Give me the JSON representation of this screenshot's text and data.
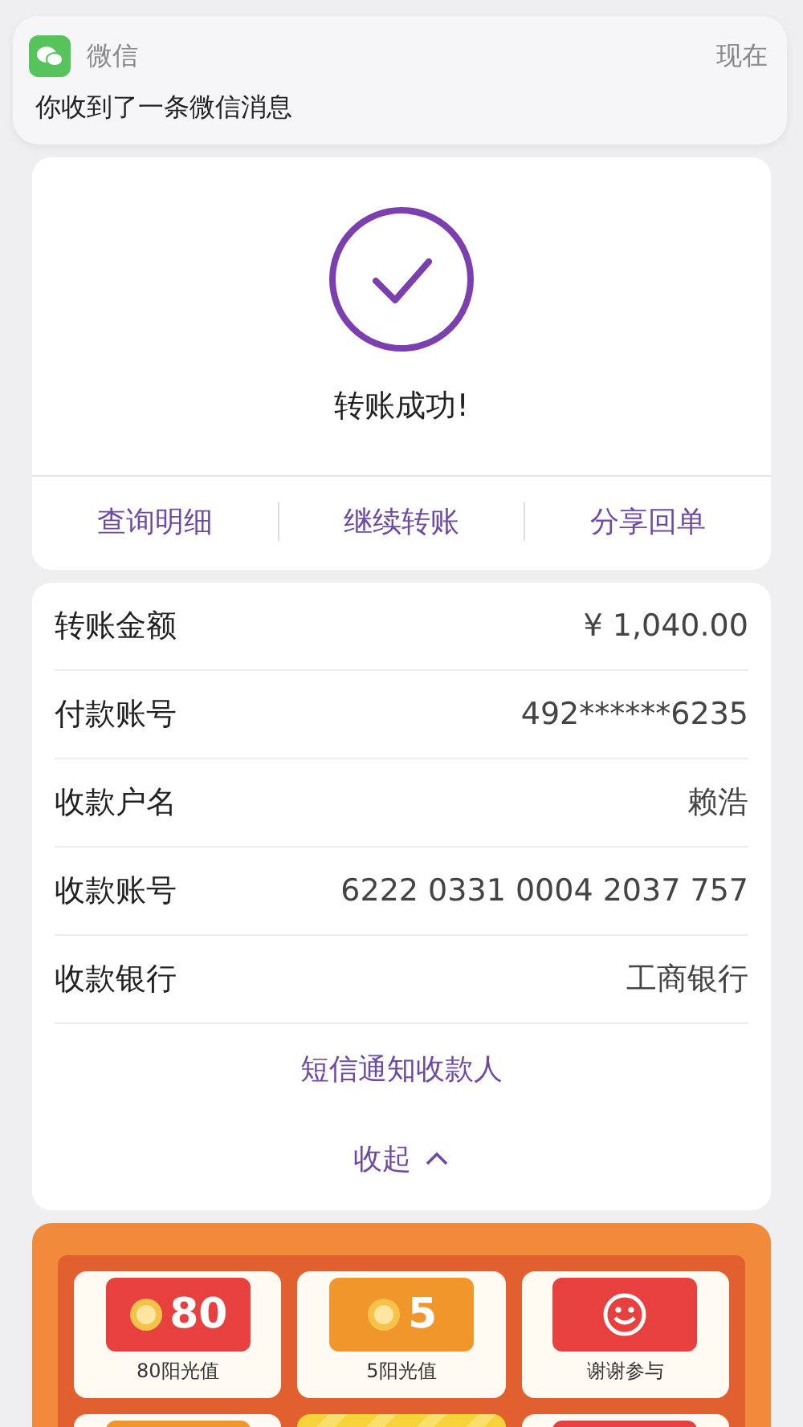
{
  "notification": {
    "app": "微信",
    "time": "现在",
    "message": "你收到了一条微信消息"
  },
  "result": {
    "title": "转账成功!",
    "actions": [
      "查询明细",
      "继续转账",
      "分享回单"
    ]
  },
  "details": {
    "rows": [
      {
        "label": "转账金额",
        "value": "¥ 1,040.00"
      },
      {
        "label": "付款账号",
        "value": "492******6235"
      },
      {
        "label": "收款户名",
        "value": "赖浩"
      },
      {
        "label": "收款账号",
        "value": "6222 0331 0004 2037 757"
      },
      {
        "label": "收款银行",
        "value": "工商银行"
      }
    ],
    "notify_link": "短信通知收款人",
    "collapse": {
      "label": "收起",
      "expanded": true
    }
  },
  "prizes": [
    {
      "kind": "coin",
      "amount": "80",
      "label": "80阳光值",
      "color": "#e8403e"
    },
    {
      "kind": "coin",
      "amount": "5",
      "label": "5阳光值",
      "color": "#f0962a"
    },
    {
      "kind": "smile",
      "label": "谢谢参与",
      "color": "#e8403e"
    },
    {
      "kind": "cut",
      "color": "#f0962a"
    },
    {
      "kind": "stripe",
      "color": "#f7d23a"
    },
    {
      "kind": "cut",
      "color": "#e8403e"
    }
  ]
}
